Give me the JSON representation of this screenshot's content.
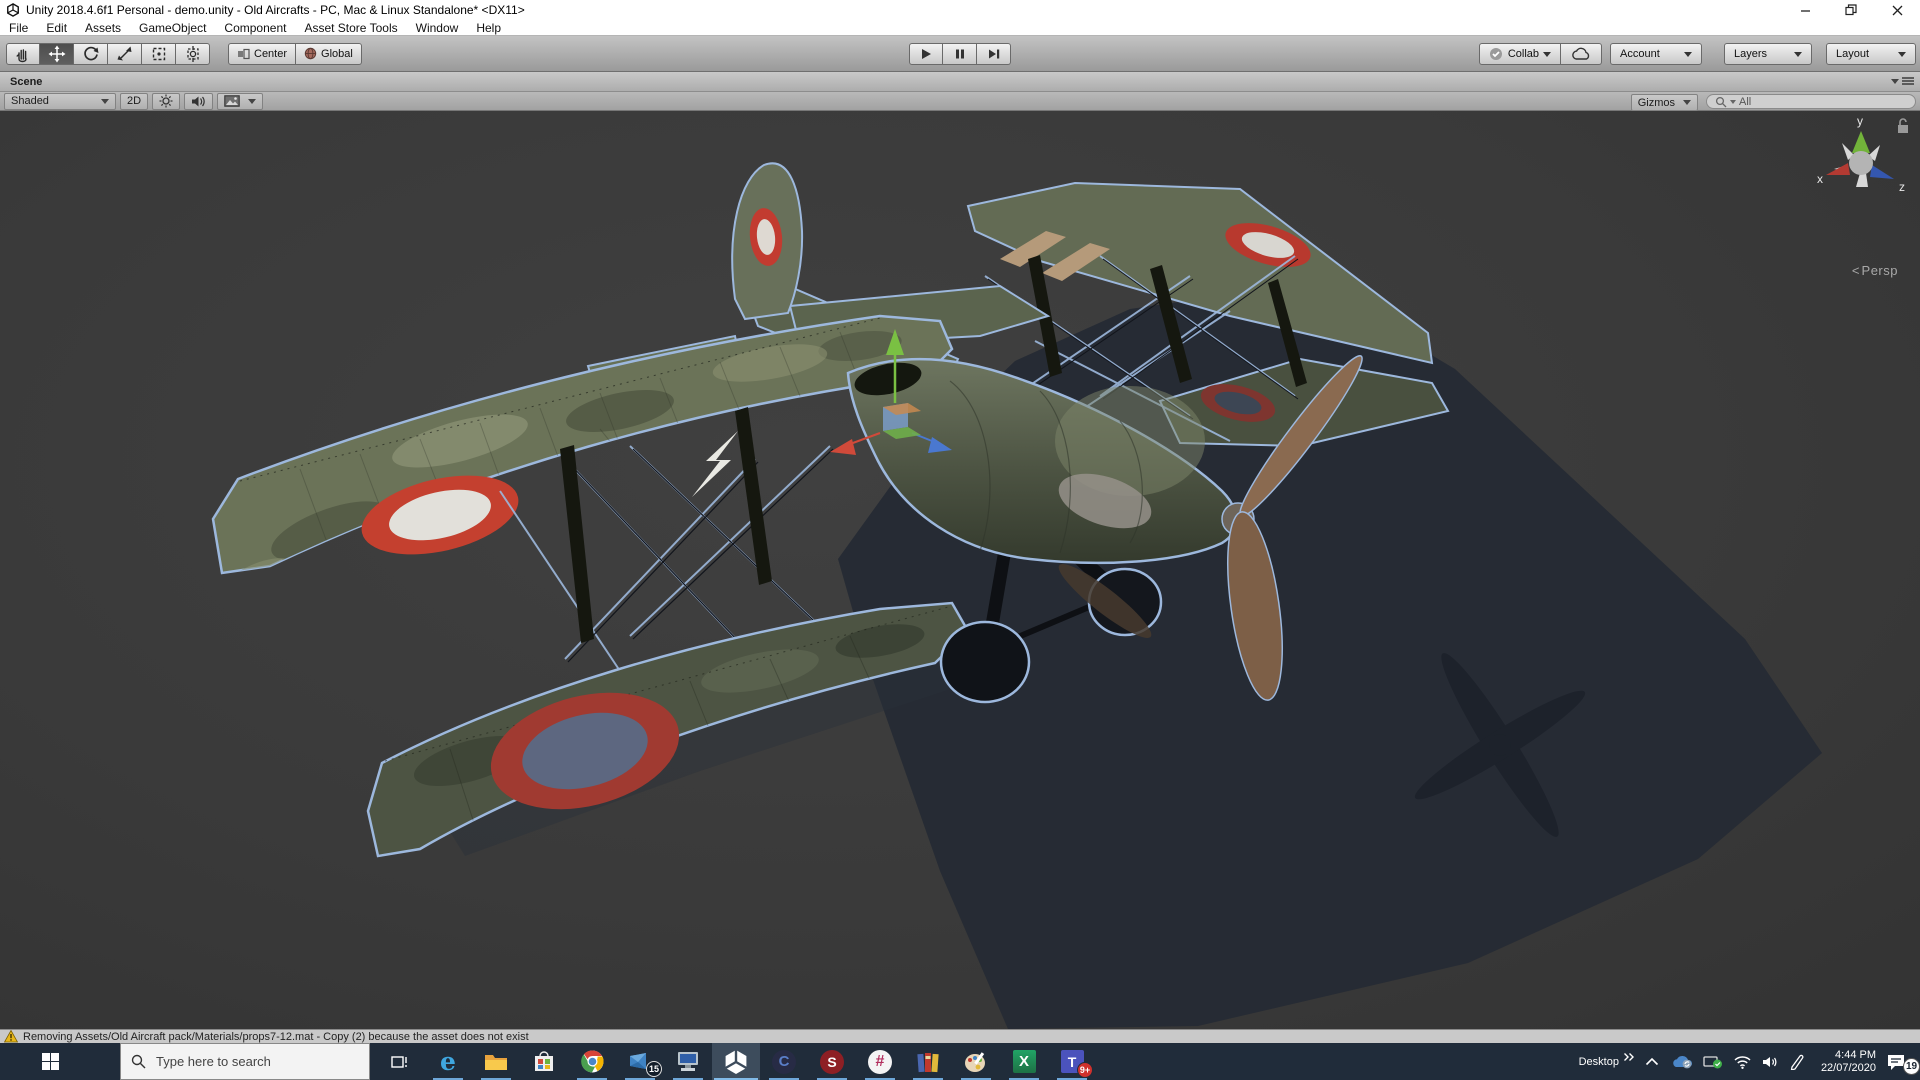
{
  "window": {
    "title": "Unity 2018.4.6f1 Personal - demo.unity - Old Aircrafts - PC, Mac & Linux Standalone* <DX11>"
  },
  "menu_bar": {
    "items": [
      "File",
      "Edit",
      "Assets",
      "GameObject",
      "Component",
      "Asset Store Tools",
      "Window",
      "Help"
    ]
  },
  "toolbar": {
    "pivot_label": "Center",
    "space_label": "Global",
    "collab_label": "Collab",
    "account_label": "Account",
    "layers_label": "Layers",
    "layout_label": "Layout"
  },
  "scene_panel": {
    "tab_label": "Scene",
    "shading_mode": "Shaded",
    "toggle_2d": "2D",
    "gizmos_label": "Gizmos",
    "search_value": "All",
    "projection_label": "Persp",
    "axis": {
      "x": "x",
      "y": "y",
      "z": "z"
    }
  },
  "status_bar": {
    "message": "Removing Assets/Old Aircraft pack/Materials/props7-12.mat - Copy (2) because the asset does not exist"
  },
  "taskbar": {
    "search_placeholder": "Type here to search",
    "desktop_label": "Desktop",
    "time": "4:44 PM",
    "date": "22/07/2020",
    "badges": {
      "mail": "15",
      "teams": "9+",
      "notifications": "19"
    },
    "glyphs": {
      "edge": "e",
      "cinema": "C",
      "substance": "S",
      "slack": "#",
      "excel": "X",
      "teams": "T"
    }
  },
  "colors": {
    "selection_outline": "#9db8dd",
    "axis_x": "#d04a3a",
    "axis_y": "#7ac043",
    "axis_z": "#4a78d0",
    "taskbar_bg": "#202c3a",
    "viewport_bg": "#3b3b3b",
    "warning_yellow": "#e8b71a"
  }
}
